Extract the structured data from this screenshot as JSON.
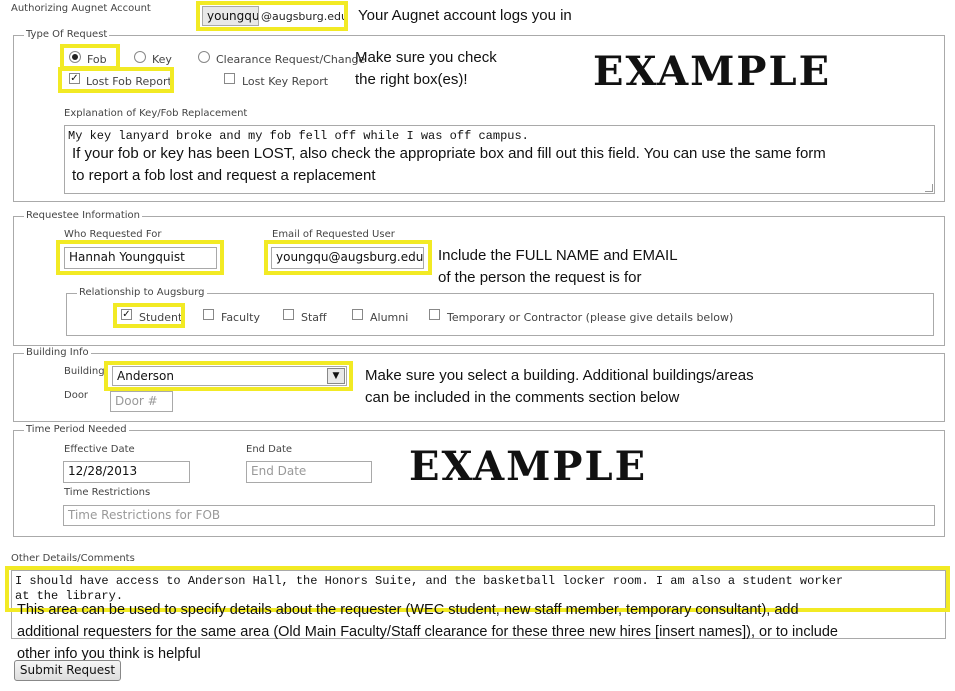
{
  "account": {
    "label": "Authorizing Augnet Account",
    "username": "youngqui",
    "domain": "@augsburg.edu",
    "note": "Your Augnet account logs you in"
  },
  "request_type": {
    "legend": "Type Of Request",
    "options": {
      "fob": "Fob",
      "key": "Key",
      "clearance": "Clearance Request/Change",
      "lost_fob": "Lost Fob Report",
      "lost_key": "Lost Key Report"
    },
    "note_line1": "Make sure you check",
    "note_line2": "the right box(es)!",
    "explanation_label": "Explanation of Key/Fob Replacement",
    "explanation_value": "My key lanyard broke and my fob fell off while I was off campus.",
    "explanation_note_line1": "If your fob or key has been LOST, also check the appropriate box and fill out this field. You can use the same form",
    "explanation_note_line2": "to report a fob lost and request a replacement"
  },
  "example_text": "EXAMPLE",
  "requestee": {
    "legend": "Requestee Information",
    "name_label": "Who Requested For",
    "name_value": "Hannah Youngquist",
    "email_label": "Email of Requested User",
    "email_value": "youngqu@augsburg.edu",
    "note_line1": "Include the FULL NAME and EMAIL",
    "note_line2": "of the person the request is for",
    "relationship_legend": "Relationship to Augsburg",
    "relationships": {
      "student": "Student",
      "faculty": "Faculty",
      "staff": "Staff",
      "alumni": "Alumni",
      "temporary": "Temporary or Contractor (please give details below)"
    }
  },
  "building": {
    "legend": "Building Info",
    "building_label": "Building",
    "building_value": "Anderson",
    "door_label": "Door",
    "door_placeholder": "Door #",
    "note_line1": "Make sure you select a building. Additional buildings/areas",
    "note_line2": "can be included in the comments section below"
  },
  "time_period": {
    "legend": "Time Period Needed",
    "effective_label": "Effective Date",
    "effective_value": "12/28/2013",
    "end_label": "End Date",
    "end_placeholder": "End Date",
    "restrictions_label": "Time Restrictions",
    "restrictions_placeholder": "Time Restrictions for FOB"
  },
  "comments": {
    "label": "Other Details/Comments",
    "value_line1": "I should have access to Anderson Hall, the Honors Suite, and the basketball locker room. I am also a student worker",
    "value_line2": "at the library.",
    "note_line1": "This area can be used to specify details about the requester (WEC student, new staff member, temporary consultant), add",
    "note_line2": "additional requesters for the same area (Old Main Faculty/Staff clearance for these three new hires [insert names]), or to include",
    "note_line3": "other info you think is helpful"
  },
  "submit_label": "Submit Request",
  "colors": {
    "highlight": "#f2ea24",
    "border": "#aaaaaa"
  }
}
